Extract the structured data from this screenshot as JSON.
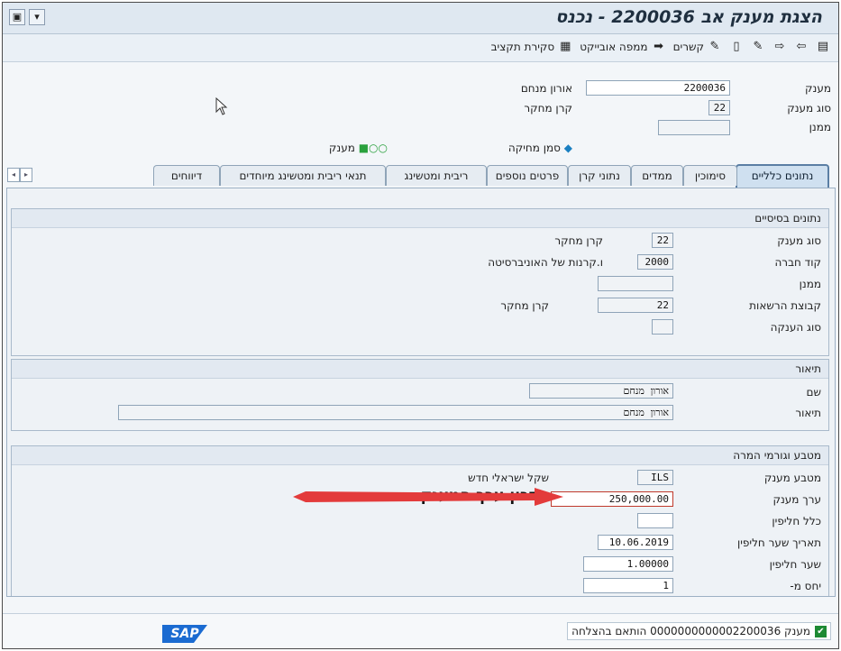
{
  "window": {
    "title": "הצגת מענק אב 2200036 - נכנס"
  },
  "toolbar": {
    "links": "קשרים",
    "object_map": "ממפה אובייקט",
    "budget_close": "סקירת תקציב"
  },
  "header": {
    "grant_label": "מענק",
    "grant_value": "2200036",
    "grant_name": "אורון מנחם",
    "grant_type_label": "סוג מענק",
    "grant_type_value": "22",
    "grant_type_desc": "קרן מחקר",
    "sponsor_label": "ממנן",
    "sponsor_value": "",
    "deletion_flag": "סמן מחיקה",
    "grant_status": "מענק"
  },
  "tabs": [
    "נתונים כלליים",
    "סימוכין",
    "ממדים",
    "נתוני קרן",
    "פרטים נוספים",
    "ריבית ומטשינג",
    "תנאי ריבית ומטשינג מיוחדים",
    "דיווחים"
  ],
  "basic": {
    "title": "נתונים בסיסיים",
    "grant_type_label": "סוג מענק",
    "grant_type_value": "22",
    "grant_type_desc": "קרן מחקר",
    "company_code_label": "קוד חברה",
    "company_code_value": "2000",
    "company_code_desc": "ו.קרנות של האוניברסיטה",
    "sponsor_label": "ממנן",
    "sponsor_value": "",
    "auth_group_label": "קבוצת הרשאות",
    "auth_group_value": "22",
    "auth_group_desc": "קרן מחקר",
    "award_type_label": "סוג הענקה",
    "award_type_value": ""
  },
  "description": {
    "title": "תיאור",
    "name_label": "שם",
    "name_value": "אורון מנחם",
    "desc_label": "תיאור",
    "desc_value": "אורון מנחם"
  },
  "currency": {
    "title": "מטבע וגורמי המרה",
    "grant_currency_label": "מטבע מענק",
    "grant_currency_value": "ILS",
    "grant_currency_desc": "שקל ישראלי חדש",
    "grant_value_label": "ערך מענק",
    "grant_value_value": "250,000.00",
    "exchange_rule_label": "כלל חליפין",
    "exchange_rule_value": "",
    "exchange_date_label": "תאריך שער חליפין",
    "exchange_date_value": "10.06.2019",
    "exchange_rate_label": "שער חליפין",
    "exchange_rate_value": "1.00000",
    "ratio_label": "יחס מ-",
    "ratio_value": "1"
  },
  "annotation": {
    "text": "עדכון ערך המענק"
  },
  "status": {
    "message": "מענק 0000000000002200036 הותאם בהצלחה",
    "logo": "SAP"
  },
  "colors": {
    "arrow": "#e33b3b",
    "success": "#1e8a33",
    "accent": "#1b6bd1"
  }
}
